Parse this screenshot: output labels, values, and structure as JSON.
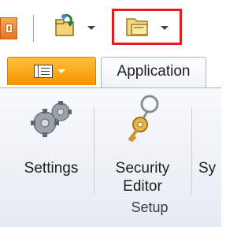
{
  "quick_access": {
    "buttons": [
      {
        "name": "app-menu-icon"
      },
      {
        "name": "open-icon"
      },
      {
        "name": "folder-icon"
      }
    ]
  },
  "tabs": {
    "application": "Application"
  },
  "ribbon": {
    "settings_label": "Settings",
    "security_editor_line1": "Security",
    "security_editor_line2": "Editor",
    "next_label_partial": "Sy",
    "group_label": "Setup"
  },
  "colors": {
    "highlight": "#e41e1e",
    "menu_tab": "#f59300",
    "app_icon": "#e8741e"
  }
}
